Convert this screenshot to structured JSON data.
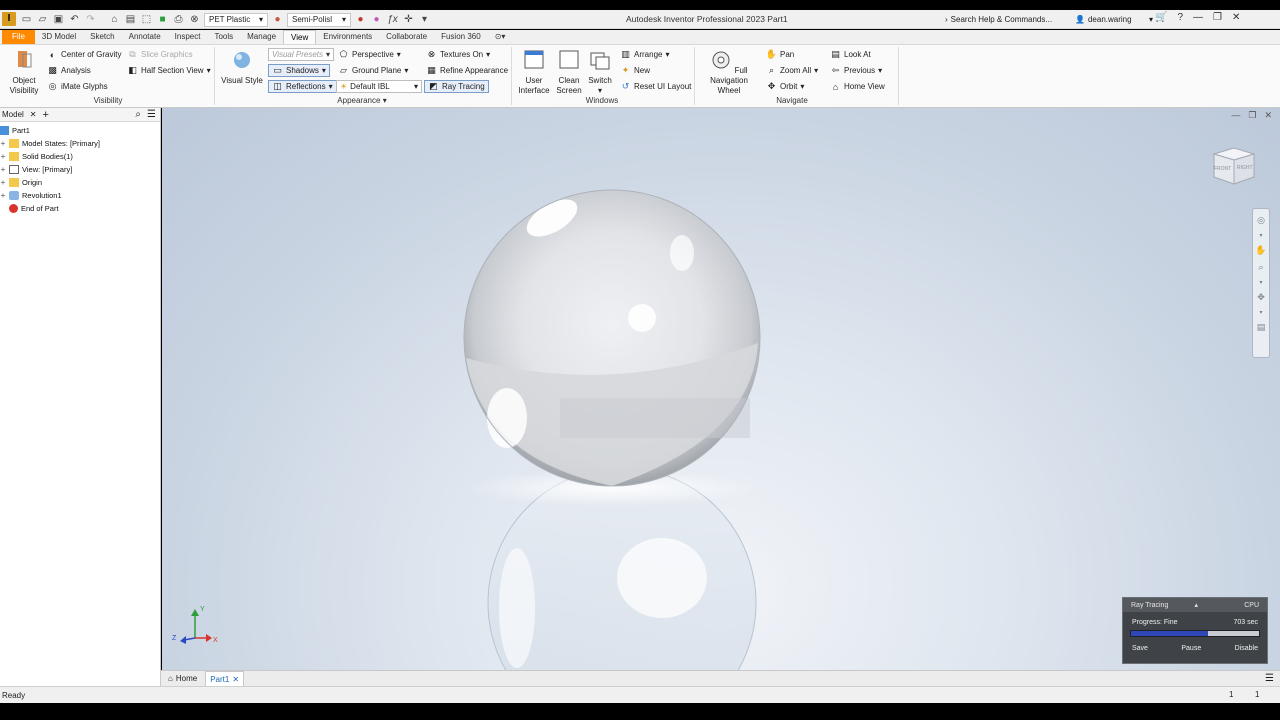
{
  "window": {
    "title": "Autodesk Inventor Professional 2023   Part1",
    "app_icon_letter": "I"
  },
  "qat": {
    "material": "PET Plastic",
    "appearance": "Semi-Polisl"
  },
  "help": {
    "search_placeholder": "Search Help & Commands..."
  },
  "user": {
    "name": "dean.waring"
  },
  "ribbon_tabs": [
    "File",
    "3D Model",
    "Sketch",
    "Annotate",
    "Inspect",
    "Tools",
    "Manage",
    "View",
    "Environments",
    "Collaborate",
    "Fusion 360"
  ],
  "active_tab": "View",
  "ribbon": {
    "visibility": {
      "label": "Visibility",
      "object_visibility": "Object\nVisibility",
      "center_of_gravity": "Center of Gravity",
      "slice_graphics": "Slice Graphics",
      "analysis": "Analysis",
      "half_section_view": "Half Section View",
      "imate_glyphs": "iMate Glyphs"
    },
    "appearance": {
      "label": "Appearance",
      "visual_style": "Visual Style",
      "visual_presets": "Visual Presets",
      "perspective": "Perspective",
      "textures_on": "Textures On",
      "shadows": "Shadows",
      "ground_plane": "Ground Plane",
      "refine_appearance": "Refine Appearance",
      "reflections": "Reflections",
      "default_ibl": "Default IBL",
      "ray_tracing": "Ray Tracing"
    },
    "windows": {
      "label": "Windows",
      "user_interface": "User\nInterface",
      "clean_screen": "Clean\nScreen",
      "switch": "Switch",
      "arrange": "Arrange",
      "new": "New",
      "reset_ui": "Reset UI Layout"
    },
    "navigate": {
      "label": "Navigate",
      "full_nav_wheel": "Full Navigation\nWheel",
      "pan": "Pan",
      "zoom_all": "Zoom All",
      "orbit": "Orbit",
      "look_at": "Look At",
      "previous": "Previous",
      "home_view": "Home View"
    }
  },
  "browser": {
    "tab": "Model",
    "items": [
      {
        "label": "Part1",
        "expander": ""
      },
      {
        "label": "Model States: [Primary]",
        "expander": "+"
      },
      {
        "label": "Solid Bodies(1)",
        "expander": "+"
      },
      {
        "label": "View: [Primary]",
        "expander": "+"
      },
      {
        "label": "Origin",
        "expander": "+"
      },
      {
        "label": "Revolution1",
        "expander": "+"
      },
      {
        "label": "End of Part",
        "expander": ""
      }
    ]
  },
  "viewcube": {
    "front": "FRONT",
    "right": "RIGHT"
  },
  "triad": {
    "x": "X",
    "y": "Y",
    "z": "Z"
  },
  "ray_tracing": {
    "title": "Ray Tracing",
    "engine": "CPU",
    "progress_label": "Progress: Fine",
    "time": "703 sec",
    "progress": 0.6,
    "save": "Save",
    "pause": "Pause",
    "disable": "Disable"
  },
  "doc_tabs": {
    "home": "Home",
    "part": "Part1"
  },
  "status": {
    "text": "Ready",
    "count1": "1",
    "count2": "1"
  }
}
